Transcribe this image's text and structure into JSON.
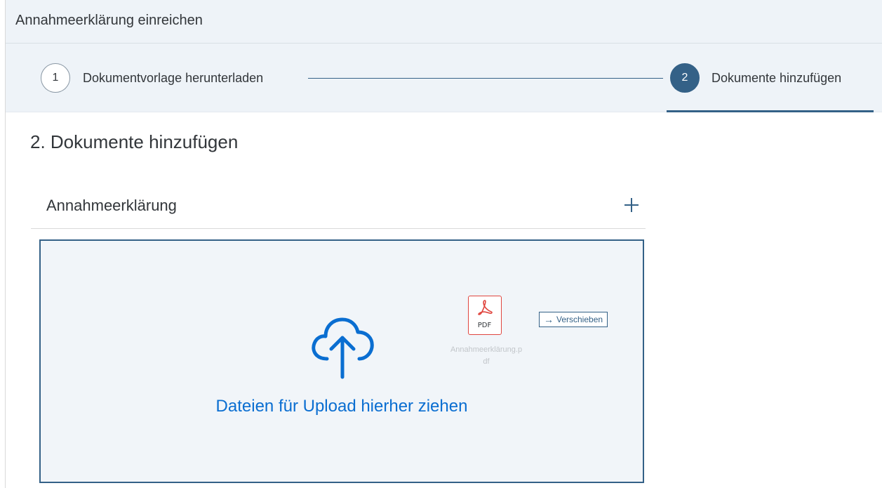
{
  "header": {
    "title": "Annahmeerklärung einreichen"
  },
  "wizard": {
    "steps": [
      {
        "number": "1",
        "label": "Dokumentvorlage herunterladen"
      },
      {
        "number": "2",
        "label": "Dokumente hinzufügen"
      }
    ],
    "active_step": 2
  },
  "section": {
    "title": "2. Dokumente hinzufügen"
  },
  "panel": {
    "title": "Annahmeerklärung",
    "add_icon": "plus-icon"
  },
  "dropzone": {
    "text": "Dateien für Upload hierher ziehen",
    "icon": "cloud-upload-icon",
    "dragged_file": {
      "type_label": "PDF",
      "name_line1": "Annahmeerklärung.p",
      "name_line2": "df"
    },
    "move_badge": {
      "arrow": "→",
      "label": "Verschieben"
    }
  },
  "colors": {
    "accent": "#346187",
    "link": "#0a6ed1",
    "header_bg": "#eef3f8",
    "pdf_red": "#e0463f"
  }
}
